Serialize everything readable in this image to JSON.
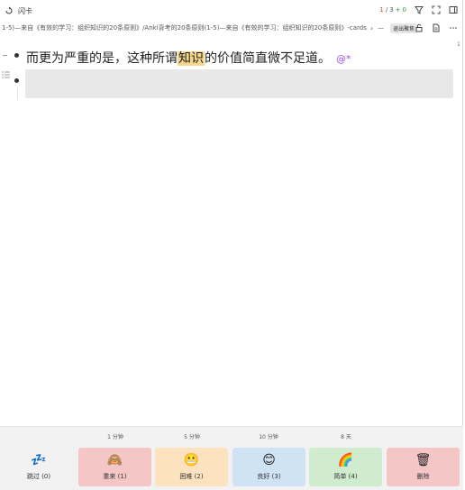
{
  "titlebar": {
    "title": "闪卡",
    "counter": {
      "current": "1",
      "separator": "/",
      "total": "3",
      "plus": "+",
      "new": "0"
    }
  },
  "breadcrumb": {
    "text": "1-5)—来自《有效的学习：组织知识的20条原则》/Anki背考的20条原则(1-5)—来自《有效的学习：组织知识的20条原则》-cards",
    "chevron": "›",
    "dash": "—",
    "exit_label": "退出聚焦"
  },
  "page_badge": "1",
  "card": {
    "text_before": "而更为严重的是，这种所谓",
    "highlight": "知识",
    "text_after": "的价值简直微不足道。",
    "ref": "@*"
  },
  "review": {
    "buttons": [
      {
        "interval": "",
        "emoji": "💤",
        "label": "跳过 (0)",
        "bg": "#f2f2f2"
      },
      {
        "interval": "1 分钟",
        "emoji": "🙈",
        "label": "重来 (1)",
        "bg": "#f5c6c6"
      },
      {
        "interval": "5 分钟",
        "emoji": "😬",
        "label": "困难 (2)",
        "bg": "#fde2bf"
      },
      {
        "interval": "10 分钟",
        "emoji": "😊",
        "label": "良好 (3)",
        "bg": "#cfe3f5"
      },
      {
        "interval": "8 天",
        "emoji": "🌈",
        "label": "简单 (4)",
        "bg": "#cfeccf"
      },
      {
        "interval": "",
        "emoji": "🗑",
        "label": "删除",
        "bg": "#f5c6c6"
      }
    ]
  }
}
